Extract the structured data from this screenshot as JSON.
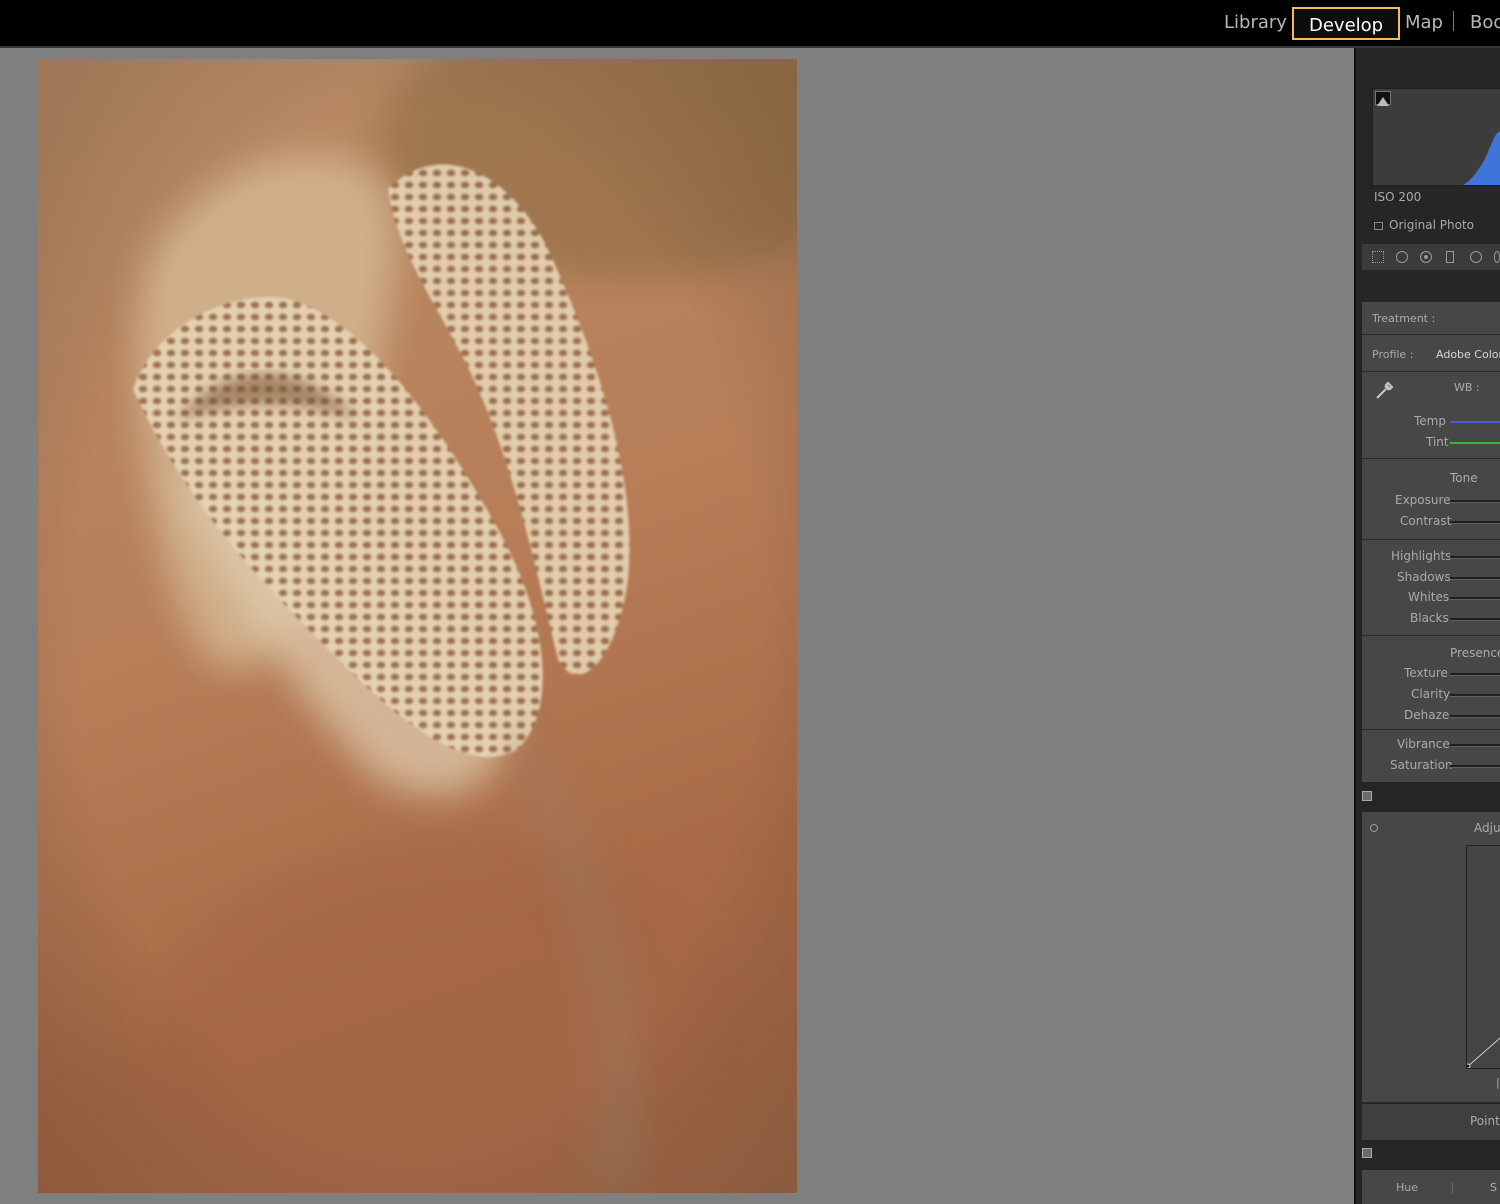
{
  "modules": {
    "library": "Library",
    "develop": "Develop",
    "map": "Map",
    "book": "Boo"
  },
  "histogram": {
    "iso": "ISO 200",
    "original_photo": "Original Photo"
  },
  "basic": {
    "treatment_label": "Treatment :",
    "profile_label": "Profile :",
    "profile_value": "Adobe Color",
    "wb_label": "WB :",
    "temp": "Temp",
    "tint": "Tint",
    "tone_header": "Tone",
    "exposure": "Exposure",
    "contrast": "Contrast",
    "highlights": "Highlights",
    "shadows": "Shadows",
    "whites": "Whites",
    "blacks": "Blacks",
    "presence_header": "Presence",
    "texture": "Texture",
    "clarity": "Clarity",
    "dehaze": "Dehaze",
    "vibrance": "Vibrance",
    "saturation": "Saturation"
  },
  "tone_curve": {
    "header": "Adjus",
    "point_label": "Point"
  },
  "hsl": {
    "hue_tab": "Hue",
    "sat_tab": "S"
  },
  "colors": {
    "accent": "#f0bc5e",
    "histogram_blue": "#3f74d9",
    "temp_track": "#4a5bd0",
    "tint_track": "#3db043"
  }
}
